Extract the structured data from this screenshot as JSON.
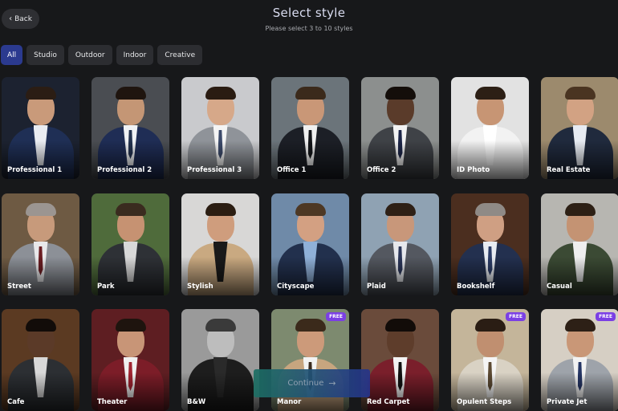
{
  "header": {
    "back_label": "Back",
    "title": "Select style",
    "subtitle": "Please select 3 to 10 styles"
  },
  "filters": [
    "All",
    "Studio",
    "Outdoor",
    "Indoor",
    "Creative"
  ],
  "active_filter": "All",
  "styles": [
    {
      "label": "Professional 1",
      "free": false,
      "bg": "#1c2230",
      "suit": "#1f2f55",
      "shirt": "#e9ecf2",
      "tie": "",
      "skin": "#c99a7a",
      "hair": "#2b1d14"
    },
    {
      "label": "Professional 2",
      "free": false,
      "bg": "#4a4d52",
      "suit": "#1f2d55",
      "shirt": "#f0f2f5",
      "tie": "#23324f",
      "skin": "#c49675",
      "hair": "#1f150f"
    },
    {
      "label": "Professional 3",
      "free": false,
      "bg": "#c9cacd",
      "suit": "#8f9399",
      "shirt": "#f4f4f4",
      "tie": "#3c4a6a",
      "skin": "#d6a889",
      "hair": "#2a1c12"
    },
    {
      "label": "Office 1",
      "free": false,
      "bg": "#6b747a",
      "suit": "#1c1f26",
      "shirt": "#f0f0f0",
      "tie": "#121418",
      "skin": "#c99777",
      "hair": "#3b2a1b"
    },
    {
      "label": "Office 2",
      "free": false,
      "bg": "#8c8f8e",
      "suit": "#3f4247",
      "shirt": "#f3f3f3",
      "tie": "#1c2547",
      "skin": "#5a3b2a",
      "hair": "#140e0a"
    },
    {
      "label": "ID Photo",
      "free": false,
      "bg": "#e2e2e2",
      "suit": "#f2f2f2",
      "shirt": "#ffffff",
      "tie": "",
      "skin": "#c79574",
      "hair": "#2c1f15"
    },
    {
      "label": "Real Estate",
      "free": false,
      "bg": "#9c8a6d",
      "suit": "#202a3d",
      "shirt": "#e7ebf2",
      "tie": "",
      "skin": "#d2a283",
      "hair": "#4a3421"
    },
    {
      "label": "Street",
      "free": false,
      "bg": "#6e5a43",
      "suit": "#8c9097",
      "shirt": "#e8e8ea",
      "tie": "#6b1d22",
      "skin": "#c79a7b",
      "hair": "#9b9591"
    },
    {
      "label": "Park",
      "free": false,
      "bg": "#4f6b3b",
      "suit": "#2e3136",
      "shirt": "#d8d8d8",
      "tie": "",
      "skin": "#c69272",
      "hair": "#3a2b1f"
    },
    {
      "label": "Stylish",
      "free": false,
      "bg": "#d8d7d6",
      "suit": "#c9a981",
      "shirt": "#1a1a1a",
      "tie": "",
      "skin": "#cf9d7d",
      "hair": "#2b1d12"
    },
    {
      "label": "Cityscape",
      "free": false,
      "bg": "#6f8aa8",
      "suit": "#22304d",
      "shirt": "#8fb0d8",
      "tie": "",
      "skin": "#d3a082",
      "hair": "#4d3824"
    },
    {
      "label": "Plaid",
      "free": false,
      "bg": "#8fa2b3",
      "suit": "#545860",
      "shirt": "#e6e8ec",
      "tie": "#2a3558",
      "skin": "#c8977a",
      "hair": "#2e2016"
    },
    {
      "label": "Bookshelf",
      "free": false,
      "bg": "#4b2e1f",
      "suit": "#23304f",
      "shirt": "#e8ecf2",
      "tie": "#2a3b66",
      "skin": "#cf9f83",
      "hair": "#8f8a86"
    },
    {
      "label": "Casual",
      "free": false,
      "bg": "#b7b6b1",
      "suit": "#3b4a34",
      "shirt": "#efefef",
      "tie": "",
      "skin": "#c49373",
      "hair": "#2d2015"
    },
    {
      "label": "Cafe",
      "free": false,
      "bg": "#5b3a22",
      "suit": "#2c2f33",
      "shirt": "#d8d8d8",
      "tie": "",
      "skin": "#5b3a28",
      "hair": "#120c09"
    },
    {
      "label": "Theater",
      "free": false,
      "bg": "#5e1e22",
      "suit": "#7c1d28",
      "shirt": "#f0f0f0",
      "tie": "#a02331",
      "skin": "#c89577",
      "hair": "#1e140e"
    },
    {
      "label": "B&W",
      "free": false,
      "bg": "#9a9a9a",
      "suit": "#1d1d1d",
      "shirt": "#2a2a2a",
      "tie": "",
      "skin": "#bdbdbd",
      "hair": "#3a3a3a"
    },
    {
      "label": "Manor",
      "free": true,
      "bg": "#7d8a6f",
      "suit": "#c7a57f",
      "shirt": "#f2f2f2",
      "tie": "#3a2a1e",
      "skin": "#cc9a7a",
      "hair": "#3b2a1b"
    },
    {
      "label": "Red Carpet",
      "free": false,
      "bg": "#6a4b3b",
      "suit": "#7a1f2b",
      "shirt": "#f3f3f3",
      "tie": "#111111",
      "skin": "#5e3d2b",
      "hair": "#120c09"
    },
    {
      "label": "Opulent Steps",
      "free": true,
      "bg": "#c4b59a",
      "suit": "#d9d2c4",
      "shirt": "#f5f5f5",
      "tie": "#5c4a33",
      "skin": "#c08f70",
      "hair": "#2a1d14"
    },
    {
      "label": "Private Jet",
      "free": true,
      "bg": "#d6cfc4",
      "suit": "#9ea3aa",
      "shirt": "#f2f2f2",
      "tie": "#253564",
      "skin": "#c99777",
      "hair": "#2d2016"
    }
  ],
  "free_badge_label": "FREE",
  "continue_label": "Continue",
  "icons": {
    "back": "chevron-left-icon",
    "continue": "arrow-right-icon"
  }
}
